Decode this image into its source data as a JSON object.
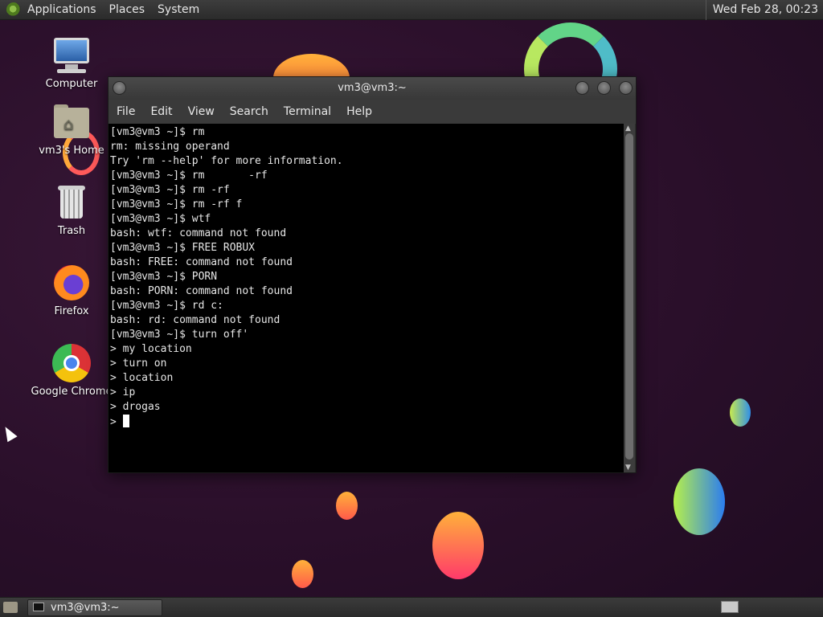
{
  "top_panel": {
    "menus": [
      "Applications",
      "Places",
      "System"
    ],
    "clock": "Wed Feb 28, 00:23"
  },
  "desktop_icons": [
    {
      "label": "Computer",
      "icon": "computer-icon"
    },
    {
      "label": "vm3's Home",
      "icon": "home-folder-icon"
    },
    {
      "label": "Trash",
      "icon": "trash-icon"
    },
    {
      "label": "Firefox",
      "icon": "firefox-icon"
    },
    {
      "label": "Google Chrome",
      "icon": "chrome-icon"
    }
  ],
  "terminal": {
    "title": "vm3@vm3:~",
    "menu": [
      "File",
      "Edit",
      "View",
      "Search",
      "Terminal",
      "Help"
    ],
    "lines": [
      "[vm3@vm3 ~]$ rm",
      "rm: missing operand",
      "Try 'rm --help' for more information.",
      "[vm3@vm3 ~]$ rm       -rf",
      "[vm3@vm3 ~]$ rm -rf",
      "[vm3@vm3 ~]$ rm -rf f",
      "[vm3@vm3 ~]$ wtf",
      "bash: wtf: command not found",
      "[vm3@vm3 ~]$ FREE ROBUX",
      "bash: FREE: command not found",
      "[vm3@vm3 ~]$ PORN",
      "bash: PORN: command not found",
      "[vm3@vm3 ~]$ rd c:",
      "bash: rd: command not found",
      "[vm3@vm3 ~]$ turn off'",
      "> my location",
      "> turn on",
      "> location",
      "> ip",
      "> drogas"
    ],
    "prompt": "> "
  },
  "taskbar": {
    "task_label": "vm3@vm3:~"
  },
  "colors": {
    "panel": "#2f2f2f",
    "desktop_bg": "#2a0f2a",
    "terminal_bg": "#000000",
    "terminal_fg": "#e6e6e6"
  }
}
